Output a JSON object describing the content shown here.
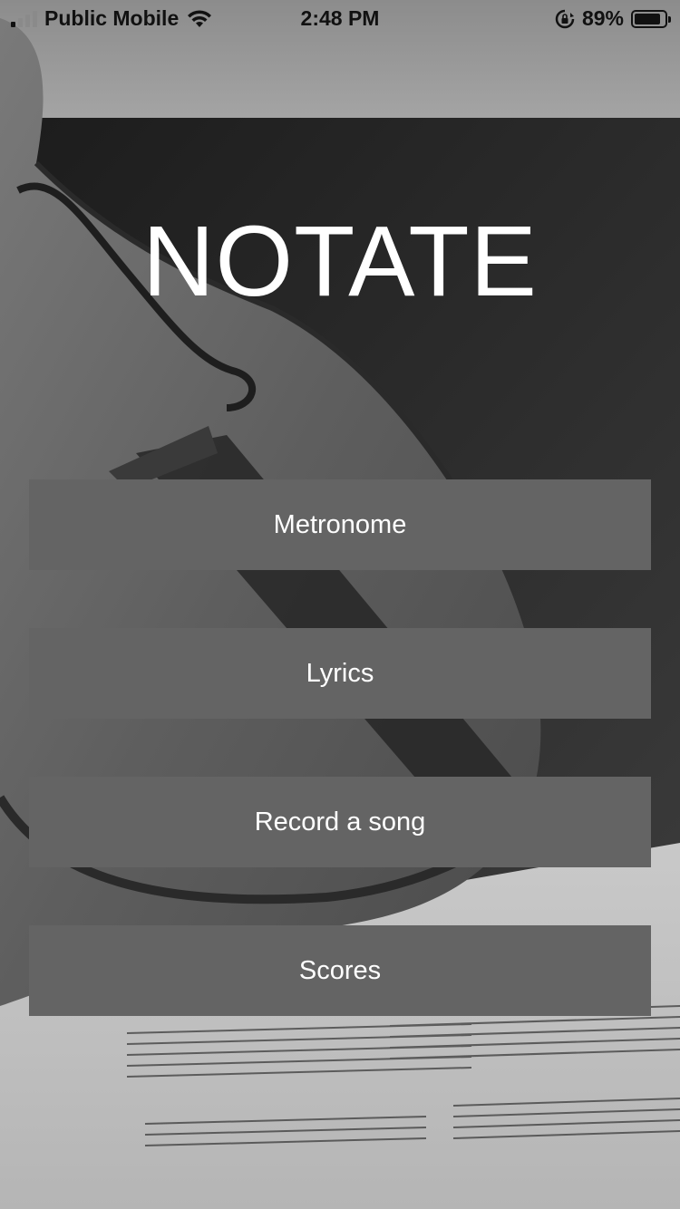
{
  "status_bar": {
    "carrier": "Public Mobile",
    "time": "2:48 PM",
    "battery_percent": "89%",
    "battery_level": 0.89,
    "icons": [
      "signal-icon",
      "wifi-icon",
      "orientation-lock-icon",
      "battery-icon"
    ]
  },
  "app": {
    "title": "NOTATE"
  },
  "menu": {
    "items": [
      {
        "label": "Metronome"
      },
      {
        "label": "Lyrics"
      },
      {
        "label": "Record a song"
      },
      {
        "label": "Scores"
      }
    ]
  },
  "colors": {
    "button_bg": "#646464",
    "button_text": "#ffffff",
    "title_text": "#ffffff"
  }
}
